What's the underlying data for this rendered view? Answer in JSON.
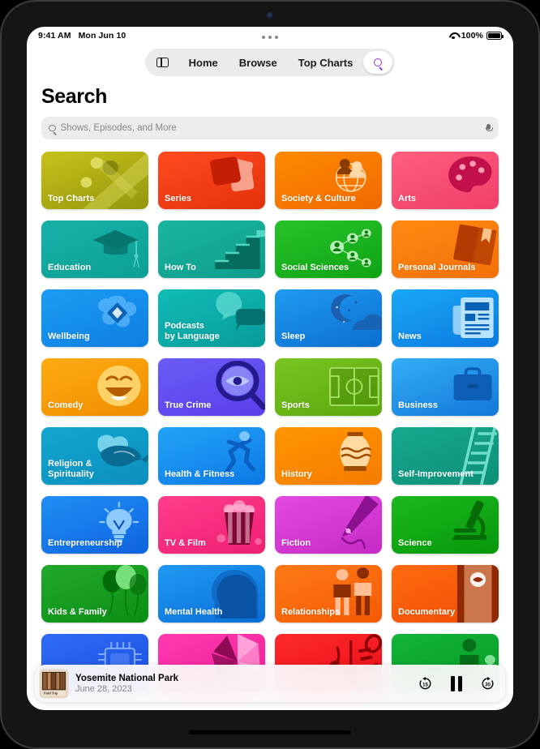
{
  "status_bar": {
    "time": "9:41 AM",
    "date": "Mon Jun 10",
    "wifi_icon": "wifi-icon",
    "battery_percent": "100%",
    "battery_icon": "battery-full-icon"
  },
  "nav": {
    "sidebar_icon": "sidebar-toggle-icon",
    "items": [
      {
        "label": "Home"
      },
      {
        "label": "Browse"
      },
      {
        "label": "Top Charts"
      }
    ],
    "search_icon": "search-icon",
    "search_icon_color": "#9332e0"
  },
  "page": {
    "title": "Search"
  },
  "search": {
    "icon": "search-icon",
    "placeholder": "Shows, Episodes, and More",
    "value": "",
    "mic_icon": "microphone-icon"
  },
  "categories": [
    {
      "label": "Top Charts",
      "art": "rocket-trail",
      "c1": "#c7c21a",
      "c2": "#95960e",
      "accent": "#7d800a",
      "accent2": "#dede63"
    },
    {
      "label": "Series",
      "art": "stacked-cards",
      "c1": "#ff4b1f",
      "c2": "#e4310b",
      "accent": "#c21f04",
      "accent2": "#f7a08c"
    },
    {
      "label": "Society & Culture",
      "art": "globe-people",
      "c1": "#ff8a00",
      "c2": "#f06a00",
      "accent": "#ffd9a8",
      "accent2": "#8a3c00"
    },
    {
      "label": "Arts",
      "art": "palette",
      "c1": "#ff5f7e",
      "c2": "#ef3f69",
      "accent": "#c2104a",
      "accent2": "#ff9db0"
    },
    {
      "label": "Education",
      "art": "grad-cap",
      "c1": "#17b2a8",
      "c2": "#0d9f95",
      "accent": "#06766f",
      "accent2": "#4fd4c9"
    },
    {
      "label": "How To",
      "art": "stairs",
      "c1": "#19b5a0",
      "c2": "#0f9d8c",
      "accent": "#046b5e",
      "accent2": "#52d8c2"
    },
    {
      "label": "Social Sciences",
      "art": "network-people",
      "c1": "#27c22b",
      "c2": "#0fa313",
      "accent": "#b7f0b5",
      "accent2": "#0a7a0d"
    },
    {
      "label": "Personal Journals",
      "art": "book",
      "c1": "#ff8a12",
      "c2": "#f3700a",
      "accent": "#b23b02",
      "accent2": "#ffc08a"
    },
    {
      "label": "Wellbeing",
      "art": "flower-diamond",
      "c1": "#1b9cf5",
      "c2": "#0e7fe0",
      "accent": "#75c4ff",
      "accent2": "#0a63b4"
    },
    {
      "label": "Podcasts\nby Language",
      "art": "speech-bubbles",
      "c1": "#11bcb6",
      "c2": "#079b9b",
      "accent": "#5fdcd2",
      "accent2": "#03716f"
    },
    {
      "label": "Sleep",
      "art": "moon-cloud",
      "c1": "#1f9bf0",
      "c2": "#0b6ed1",
      "accent": "#1b5fae",
      "accent2": "#0a4f93"
    },
    {
      "label": "News",
      "art": "newspaper",
      "c1": "#19a8f7",
      "c2": "#0c7ae0",
      "accent": "#b9e3ff",
      "accent2": "#0a62b6"
    },
    {
      "label": "Comedy",
      "art": "smiley",
      "c1": "#ffab12",
      "c2": "#ef8d00",
      "accent": "#ffd166",
      "accent2": "#b55c00"
    },
    {
      "label": "True Crime",
      "art": "eye-magnifier",
      "c1": "#6a5bf7",
      "c2": "#5a3fe8",
      "accent": "#241a8c",
      "accent2": "#b8c7ff"
    },
    {
      "label": "Sports",
      "art": "soccer-field",
      "c1": "#7ac522",
      "c2": "#5aa80c",
      "accent": "#3f7a04",
      "accent2": "#a7e063"
    },
    {
      "label": "Business",
      "art": "briefcase",
      "c1": "#34aef8",
      "c2": "#1278d8",
      "accent": "#0d5fb5",
      "accent2": "#0a4f96"
    },
    {
      "label": "Religion &\nSpirituality",
      "art": "dove",
      "c1": "#13a6cf",
      "c2": "#0b8fbe",
      "accent": "#0a6c93",
      "accent2": "#8fe0f2"
    },
    {
      "label": "Health & Fitness",
      "art": "runner",
      "c1": "#22a3f8",
      "c2": "#0d79e6",
      "accent": "#0a5fc0",
      "accent2": "#7cc6ff"
    },
    {
      "label": "History",
      "art": "vase",
      "c1": "#ff9500",
      "c2": "#f57c00",
      "accent": "#ffd9a0",
      "accent2": "#a04c00"
    },
    {
      "label": "Self-Improvement",
      "art": "ladder",
      "c1": "#16a88f",
      "c2": "#0d9077",
      "accent": "#6fddc8",
      "accent2": "#05705d"
    },
    {
      "label": "Entrepreneurship",
      "art": "lightbulb",
      "c1": "#1f8ff5",
      "c2": "#0f63df",
      "accent": "#8ec9ff",
      "accent2": "#0a4fb4"
    },
    {
      "label": "TV & Film",
      "art": "popcorn",
      "c1": "#ff3d8b",
      "c2": "#ef1f74",
      "accent": "#7d0633",
      "accent2": "#ffc2da"
    },
    {
      "label": "Fiction",
      "art": "fountain-pen",
      "c1": "#e44ae0",
      "c2": "#c52ac6",
      "accent": "#8b1190",
      "accent2": "#f7a6f2"
    },
    {
      "label": "Science",
      "art": "microscope",
      "c1": "#1cb81f",
      "c2": "#06980a",
      "accent": "#056c07",
      "accent2": "#9ae89b"
    },
    {
      "label": "Kids & Family",
      "art": "balloons",
      "c1": "#22a82c",
      "c2": "#0a8f14",
      "accent": "#046b0b",
      "accent2": "#76e07c"
    },
    {
      "label": "Mental Health",
      "art": "head-profile",
      "c1": "#1f9af5",
      "c2": "#0b6fd6",
      "accent": "#0a57ad",
      "accent2": "#0a4a96"
    },
    {
      "label": "Relationships",
      "art": "two-people",
      "c1": "#ff7a16",
      "c2": "#f35a05",
      "accent": "#ffbe94",
      "accent2": "#8c2c02"
    },
    {
      "label": "Documentary",
      "art": "film-strip",
      "c1": "#ff6b11",
      "c2": "#f04e04",
      "accent": "#ffb58a",
      "accent2": "#8f2a02"
    },
    {
      "label": "",
      "art": "microchip",
      "c1": "#2f6bf5",
      "c2": "#1a4fe0",
      "accent": "#7fa8ff",
      "accent2": "#123ab4"
    },
    {
      "label": "",
      "art": "pinwheel",
      "c1": "#ff3bb0",
      "c2": "#ef1b98",
      "accent": "#ffb6e0",
      "accent2": "#8f0a55"
    },
    {
      "label": "",
      "art": "music-notes",
      "c1": "#ff2a2a",
      "c2": "#e60e1a",
      "accent": "#ff9a9a",
      "accent2": "#8c0006"
    },
    {
      "label": "",
      "art": "parent-child",
      "c1": "#15b33a",
      "c2": "#049b24",
      "accent": "#046e18",
      "accent2": "#7fe393"
    }
  ],
  "now_playing": {
    "artwork": "podcast-cover-art",
    "title": "Yosemite National Park",
    "subtitle": "June 28, 2023",
    "skip_back_label": "15",
    "skip_back_icon": "skip-back-15-icon",
    "play_pause_icon": "pause-icon",
    "skip_forward_label": "30",
    "skip_forward_icon": "skip-forward-30-icon"
  }
}
